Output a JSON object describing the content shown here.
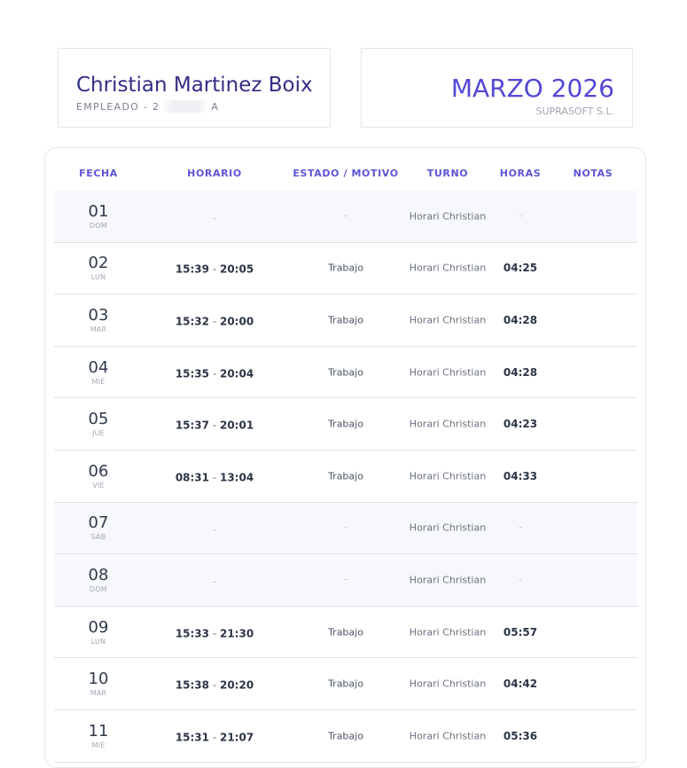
{
  "employee": {
    "name": "Christian Martinez Boix",
    "label_prefix": "EMPLEADO - 2",
    "label_suffix": "A"
  },
  "period": {
    "title": "MARZO 2026",
    "company": "SUPRASOFT S.L."
  },
  "table": {
    "headers": {
      "fecha": "FECHA",
      "horario": "HORARIO",
      "estado": "ESTADO / MOTIVO",
      "turno": "TURNO",
      "horas": "HORAS",
      "notas": "NOTAS"
    },
    "rows": [
      {
        "day": "01",
        "weekday": "DOM",
        "entrada": "",
        "salida": "",
        "estado": "-",
        "turno": "Horari Christian",
        "horas": "-",
        "weekend": true
      },
      {
        "day": "02",
        "weekday": "LUN",
        "entrada": "15:39",
        "salida": "20:05",
        "estado": "Trabajo",
        "turno": "Horari Christian",
        "horas": "04:25",
        "weekend": false
      },
      {
        "day": "03",
        "weekday": "MAR",
        "entrada": "15:32",
        "salida": "20:00",
        "estado": "Trabajo",
        "turno": "Horari Christian",
        "horas": "04:28",
        "weekend": false
      },
      {
        "day": "04",
        "weekday": "MIÉ",
        "entrada": "15:35",
        "salida": "20:04",
        "estado": "Trabajo",
        "turno": "Horari Christian",
        "horas": "04:28",
        "weekend": false
      },
      {
        "day": "05",
        "weekday": "JUE",
        "entrada": "15:37",
        "salida": "20:01",
        "estado": "Trabajo",
        "turno": "Horari Christian",
        "horas": "04:23",
        "weekend": false
      },
      {
        "day": "06",
        "weekday": "VIE",
        "entrada": "08:31",
        "salida": "13:04",
        "estado": "Trabajo",
        "turno": "Horari Christian",
        "horas": "04:33",
        "weekend": false
      },
      {
        "day": "07",
        "weekday": "SÁB",
        "entrada": "",
        "salida": "",
        "estado": "-",
        "turno": "Horari Christian",
        "horas": "-",
        "weekend": true
      },
      {
        "day": "08",
        "weekday": "DOM",
        "entrada": "",
        "salida": "",
        "estado": "-",
        "turno": "Horari Christian",
        "horas": "-",
        "weekend": true
      },
      {
        "day": "09",
        "weekday": "LUN",
        "entrada": "15:33",
        "salida": "21:30",
        "estado": "Trabajo",
        "turno": "Horari Christian",
        "horas": "05:57",
        "weekend": false
      },
      {
        "day": "10",
        "weekday": "MAR",
        "entrada": "15:38",
        "salida": "20:20",
        "estado": "Trabajo",
        "turno": "Horari Christian",
        "horas": "04:42",
        "weekend": false
      },
      {
        "day": "11",
        "weekday": "MIÉ",
        "entrada": "15:31",
        "salida": "21:07",
        "estado": "Trabajo",
        "turno": "Horari Christian",
        "horas": "05:36",
        "weekend": false
      }
    ]
  }
}
